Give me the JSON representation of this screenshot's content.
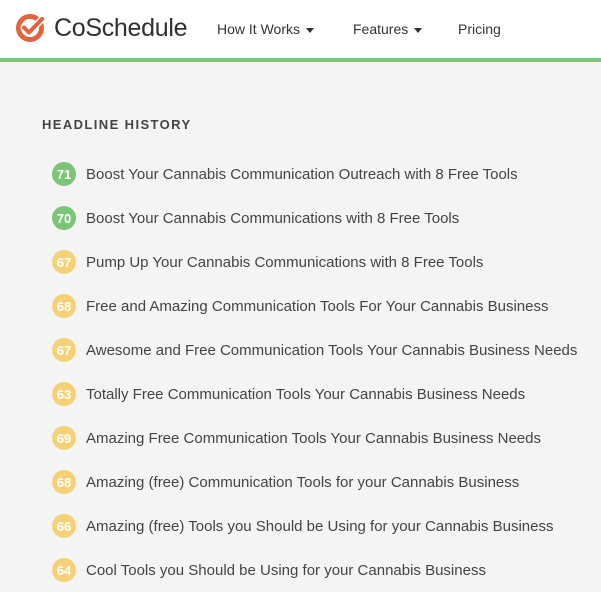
{
  "brand": {
    "name": "CoSchedule",
    "accent": "#e2643d",
    "green": "#7cc576",
    "yellow": "#f6d178"
  },
  "nav": {
    "how_it_works": "How It Works",
    "features": "Features",
    "pricing": "Pricing"
  },
  "section": {
    "title": "HEADLINE HISTORY"
  },
  "headlines": [
    {
      "score": "71",
      "status": "green",
      "text": "Boost Your Cannabis Communication Outreach with 8 Free Tools"
    },
    {
      "score": "70",
      "status": "green",
      "text": "Boost Your Cannabis Communications with 8 Free Tools"
    },
    {
      "score": "67",
      "status": "yellow",
      "text": "Pump Up Your Cannabis Communications with 8 Free Tools"
    },
    {
      "score": "68",
      "status": "yellow",
      "text": "Free and Amazing Communication Tools For Your Cannabis Business"
    },
    {
      "score": "67",
      "status": "yellow",
      "text": "Awesome and Free Communication Tools Your Cannabis Business Needs"
    },
    {
      "score": "63",
      "status": "yellow",
      "text": "Totally Free Communication Tools Your Cannabis Business Needs"
    },
    {
      "score": "69",
      "status": "yellow",
      "text": "Amazing Free Communication Tools Your Cannabis Business Needs"
    },
    {
      "score": "68",
      "status": "yellow",
      "text": "Amazing (free) Communication Tools for your Cannabis Business"
    },
    {
      "score": "66",
      "status": "yellow",
      "text": "Amazing (free) Tools you Should be Using for your Cannabis Business"
    },
    {
      "score": "64",
      "status": "yellow",
      "text": "Cool Tools you Should be Using for your Cannabis Business"
    }
  ]
}
